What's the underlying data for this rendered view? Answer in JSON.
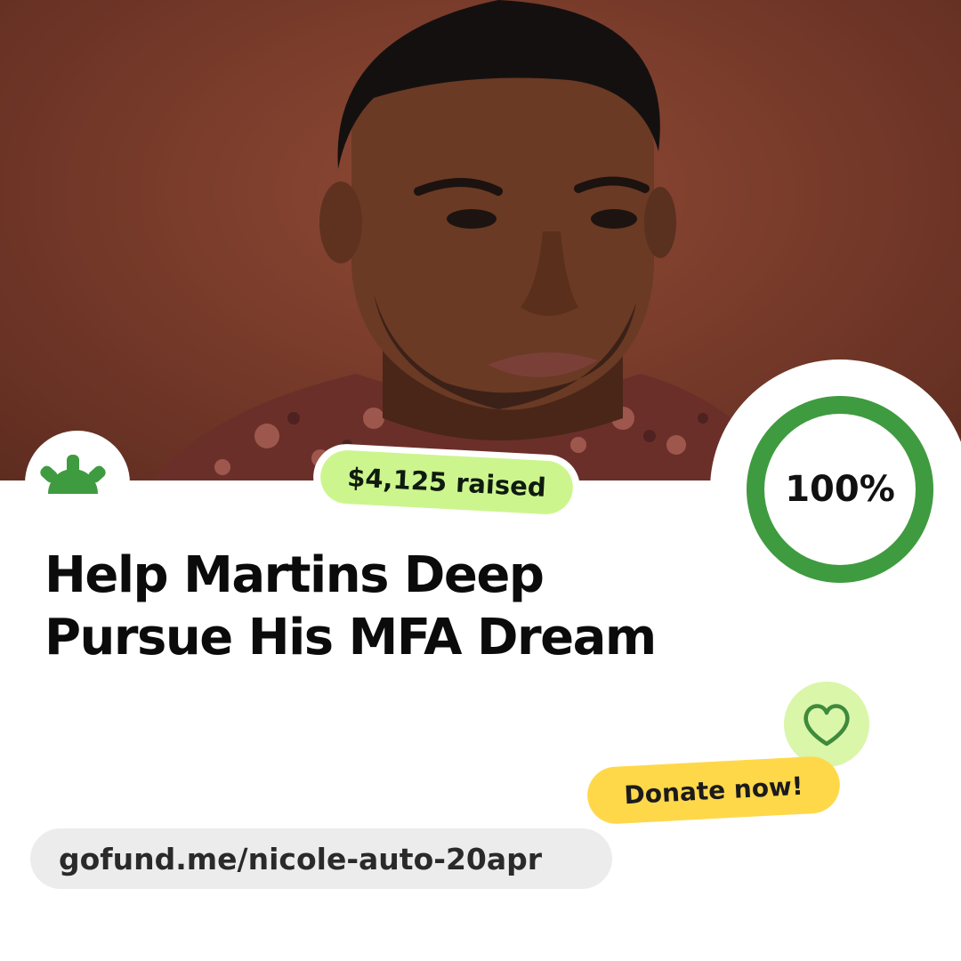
{
  "campaign": {
    "raised_label": "$4,125 raised",
    "progress_label": "100%",
    "progress_fraction": 1.0,
    "title_line1": "Help Martins Deep",
    "title_line2": "Pursue His MFA Dream",
    "donate_label": "Donate now!",
    "link": "gofund.me/nicole-auto-20apr"
  },
  "icons": {
    "logo": "gofundme-sun-logo-icon",
    "heart": "heart-icon",
    "photo": "campaign-photo"
  },
  "colors": {
    "brand_green": "#3f9b3f",
    "raised_pill": "#cdf58e",
    "donate_pill": "#ffd84a",
    "heart_circle": "#d9f6a9",
    "link_pill": "#ececec",
    "photo_background": "#7a3c2b"
  }
}
